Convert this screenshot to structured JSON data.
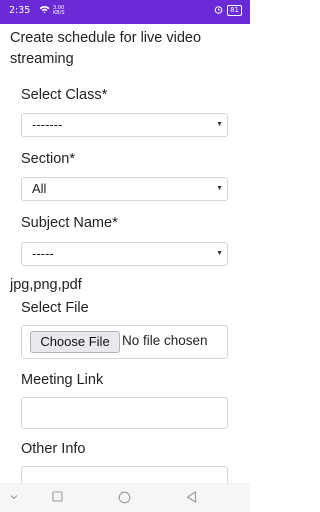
{
  "status_bar": {
    "time": "2:35",
    "data_speed": "3.00 KB/S",
    "battery": "81"
  },
  "page": {
    "title": "Create schedule for live video streaming"
  },
  "form": {
    "class": {
      "label": "Select Class*",
      "value": "-------"
    },
    "section": {
      "label": "Section*",
      "value": "All"
    },
    "subject": {
      "label": "Subject Name*",
      "value": "-----"
    },
    "file_types_note": "jpg,png,pdf",
    "file": {
      "label": "Select File",
      "button": "Choose File",
      "status": "No file chosen"
    },
    "meeting_link": {
      "label": "Meeting Link",
      "value": ""
    },
    "other_info": {
      "label": "Other Info",
      "value": ""
    }
  },
  "nav_bar": {
    "icons": [
      "chevron-down-icon",
      "recent-apps-icon",
      "home-icon",
      "back-icon"
    ]
  },
  "colors": {
    "status_bar_bg": "#6a2bd6",
    "border": "#d6d6d6"
  }
}
